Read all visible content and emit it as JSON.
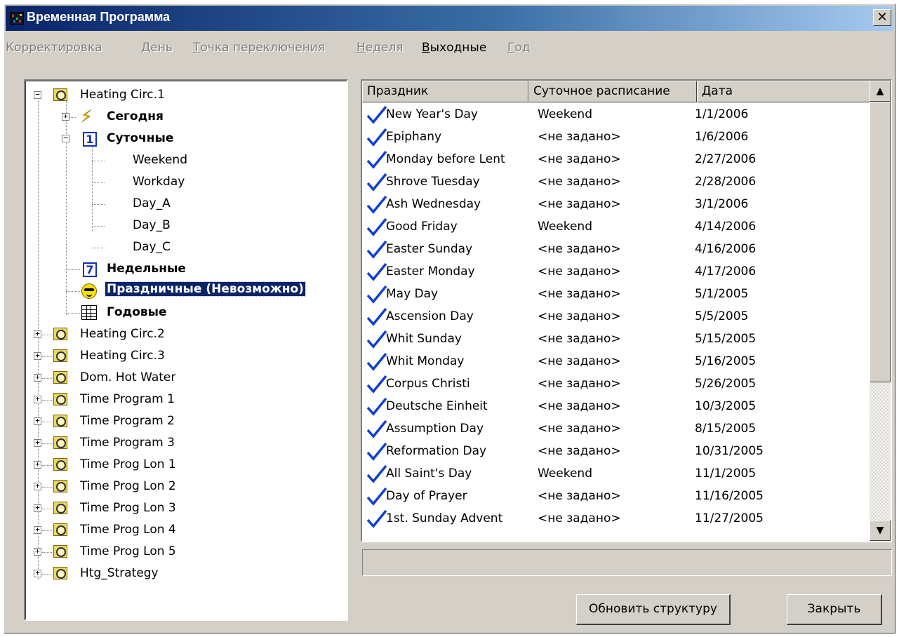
{
  "window": {
    "title": "Временная Программа"
  },
  "menu": [
    {
      "label": "Корректировка",
      "accel": "",
      "active": false
    },
    {
      "label": "День",
      "accel": "Д",
      "active": false
    },
    {
      "label": "Точка переключения",
      "accel": "Т",
      "active": false
    },
    {
      "label": "Неделя",
      "accel": "Н",
      "active": false
    },
    {
      "label": "Выходные",
      "accel": "В",
      "active": true
    },
    {
      "label": "Год",
      "accel": "Г",
      "active": false
    }
  ],
  "tree": {
    "root": "Heating Circ.1",
    "today": "Сегодня",
    "daily": "Суточные",
    "daily_items": [
      "Weekend",
      "Workday",
      "Day_A",
      "Day_B",
      "Day_C"
    ],
    "weekly": "Недельные",
    "holidays": "Праздничные (Невозможно)",
    "yearly": "Годовые",
    "others": [
      "Heating Circ.2",
      "Heating Circ.3",
      "Dom. Hot Water",
      "Time Program 1",
      "Time Program 2",
      "Time Program 3",
      "Time Prog Lon 1",
      "Time Prog Lon 2",
      "Time Prog Lon 3",
      "Time Prog Lon 4",
      "Time Prog Lon 5",
      "Htg_Strategy"
    ]
  },
  "list": {
    "columns": [
      "Праздник",
      "Суточное расписание",
      "Дата"
    ],
    "rows": [
      {
        "holiday": "New Year's Day",
        "schedule": "Weekend",
        "date": "1/1/2006"
      },
      {
        "holiday": "Epiphany",
        "schedule": "<не задано>",
        "date": "1/6/2006"
      },
      {
        "holiday": "Monday before Lent",
        "schedule": "<не задано>",
        "date": "2/27/2006"
      },
      {
        "holiday": "Shrove Tuesday",
        "schedule": "<не задано>",
        "date": "2/28/2006"
      },
      {
        "holiday": "Ash Wednesday",
        "schedule": "<не задано>",
        "date": "3/1/2006"
      },
      {
        "holiday": "Good Friday",
        "schedule": "Weekend",
        "date": "4/14/2006"
      },
      {
        "holiday": "Easter Sunday",
        "schedule": "<не задано>",
        "date": "4/16/2006"
      },
      {
        "holiday": "Easter Monday",
        "schedule": "<не задано>",
        "date": "4/17/2006"
      },
      {
        "holiday": "May Day",
        "schedule": "<не задано>",
        "date": "5/1/2005"
      },
      {
        "holiday": "Ascension Day",
        "schedule": "<не задано>",
        "date": "5/5/2005"
      },
      {
        "holiday": "Whit Sunday",
        "schedule": "<не задано>",
        "date": "5/15/2005"
      },
      {
        "holiday": "Whit Monday",
        "schedule": "<не задано>",
        "date": "5/16/2005"
      },
      {
        "holiday": "Corpus Christi",
        "schedule": "<не задано>",
        "date": "5/26/2005"
      },
      {
        "holiday": "Deutsche Einheit",
        "schedule": "<не задано>",
        "date": "10/3/2005"
      },
      {
        "holiday": "Assumption Day",
        "schedule": "<не задано>",
        "date": "8/15/2005"
      },
      {
        "holiday": "Reformation Day",
        "schedule": "<не задано>",
        "date": "10/31/2005"
      },
      {
        "holiday": "All Saint's Day",
        "schedule": "Weekend",
        "date": "11/1/2005"
      },
      {
        "holiday": "Day of Prayer",
        "schedule": "<не задано>",
        "date": "11/16/2005"
      },
      {
        "holiday": "1st. Sunday Advent",
        "schedule": "<не задано>",
        "date": "11/27/2005"
      }
    ]
  },
  "buttons": {
    "refresh": "Обновить структуру",
    "close": "Закрыть"
  },
  "colors": {
    "title_start": "#0a246a",
    "selection": "#0a246a",
    "check": "#1040d0"
  }
}
